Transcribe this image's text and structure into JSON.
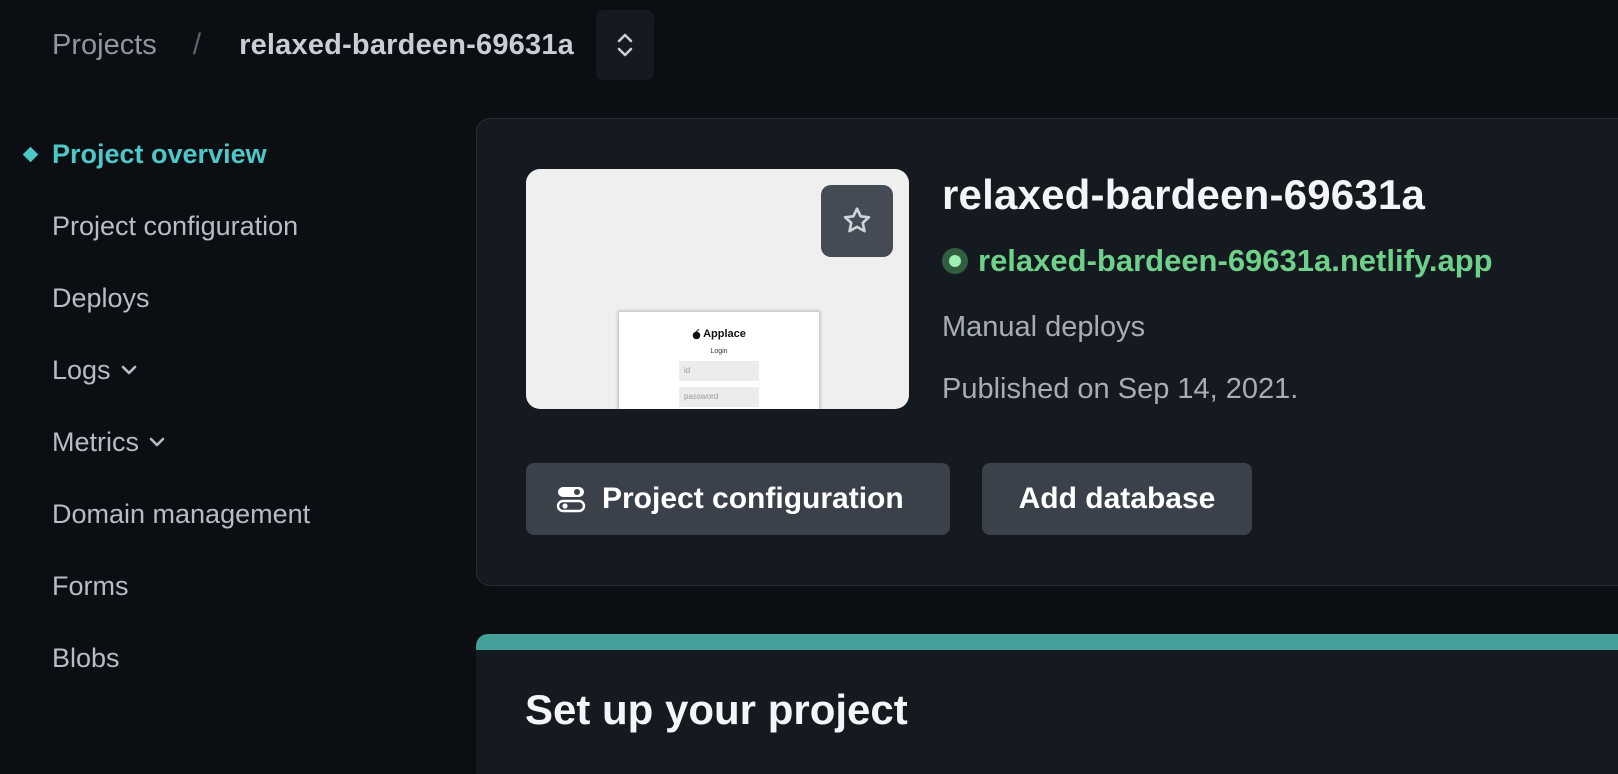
{
  "breadcrumb": {
    "root": "Projects",
    "separator": "/",
    "current": "relaxed-bardeen-69631a",
    "switcher_icon": "chevron-up-down-icon"
  },
  "sidebar": {
    "items": [
      {
        "label": "Project overview",
        "active": true
      },
      {
        "label": "Project configuration"
      },
      {
        "label": "Deploys"
      },
      {
        "label": "Logs",
        "has_dropdown": true
      },
      {
        "label": "Metrics",
        "has_dropdown": true
      },
      {
        "label": "Domain management"
      },
      {
        "label": "Forms"
      },
      {
        "label": "Blobs"
      }
    ],
    "accent_color": "#4fc7c7"
  },
  "overview": {
    "thumbnail": {
      "brand": "Applace",
      "heading": "Login",
      "id_placeholder": "id",
      "password_placeholder": "password",
      "favorite_icon": "star-icon"
    },
    "site_name": "relaxed-bardeen-69631a",
    "site_url": "relaxed-bardeen-69631a.netlify.app",
    "status_color": "#6fd08a",
    "deploy_mode": "Manual deploys",
    "published": "Published on Sep 14, 2021.",
    "buttons": {
      "config_label": "Project configuration",
      "config_icon": "toggles-icon",
      "add_db_label": "Add database"
    }
  },
  "setup": {
    "title": "Set up your project",
    "bar_color": "#46a09a"
  }
}
